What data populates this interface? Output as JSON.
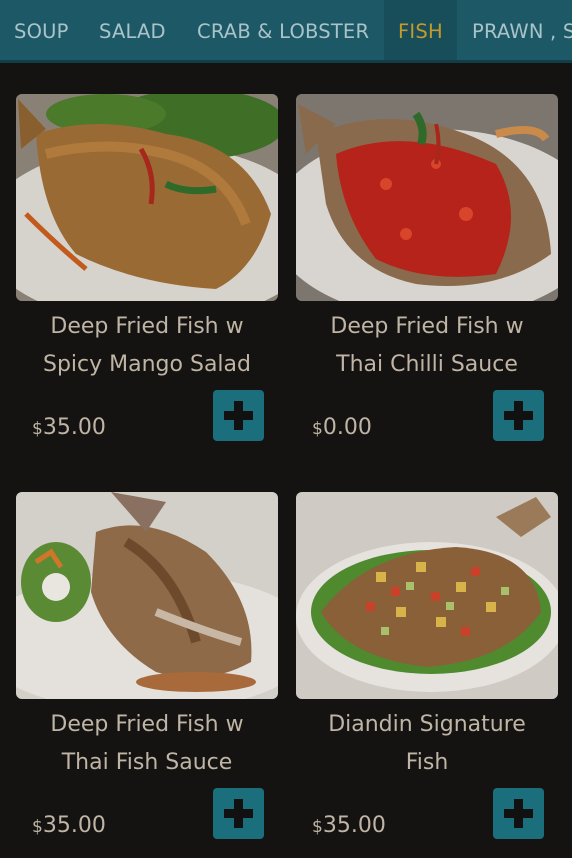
{
  "categories": [
    "SOUP",
    "SALAD",
    "CRAB & LOBSTER",
    "FISH",
    "PRAWN , S"
  ],
  "active_category": "FISH",
  "colors": {
    "tab_bar": "#1c5866",
    "active_tab_text": "#c59a2c",
    "add_button": "#1b6f7d",
    "text": "#bfb4a5"
  },
  "items": [
    {
      "name_line1": "Deep Fried Fish w",
      "name_line2": "Spicy Mango Salad",
      "currency": "$",
      "amount": "35.00",
      "add_icon": "plus-icon"
    },
    {
      "name_line1": "Deep Fried Fish w",
      "name_line2": "Thai Chilli Sauce",
      "currency": "$",
      "amount": "0.00",
      "add_icon": "plus-icon"
    },
    {
      "name_line1": "Deep Fried Fish w",
      "name_line2": "Thai Fish Sauce",
      "currency": "$",
      "amount": "35.00",
      "add_icon": "plus-icon"
    },
    {
      "name_line1": "Diandin Signature",
      "name_line2": "Fish",
      "currency": "$",
      "amount": "35.00",
      "add_icon": "plus-icon"
    }
  ]
}
